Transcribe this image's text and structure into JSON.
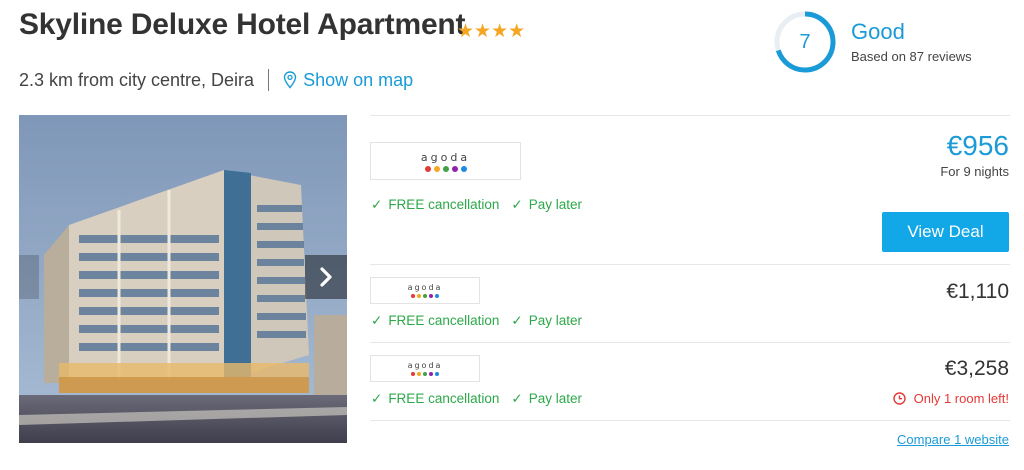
{
  "hotel": {
    "name": "Skyline Deluxe Hotel Apartment",
    "stars": "★★★★",
    "star_count": 4,
    "distance": "2.3 km from city centre, Deira",
    "map_link": "Show on map"
  },
  "rating": {
    "score": "7",
    "fraction": 0.7,
    "label": "Good",
    "reviews": "Based on 87 reviews"
  },
  "deals": [
    {
      "provider": "agoda",
      "features": [
        "FREE cancellation",
        "Pay later"
      ],
      "price": "€956",
      "price_note": "For 9 nights",
      "cta": "View Deal"
    },
    {
      "provider": "agoda",
      "features": [
        "FREE cancellation",
        "Pay later"
      ],
      "price": "€1,110"
    },
    {
      "provider": "agoda",
      "features": [
        "FREE cancellation",
        "Pay later"
      ],
      "price": "€3,258",
      "warning": "Only 1 room left!"
    }
  ],
  "compare_link": "Compare 1 website",
  "colors": {
    "accent": "#1a9bd7",
    "button": "#12a7e6",
    "star": "#f5a623",
    "feature_green": "#2da84a",
    "warning_red": "#e53935",
    "agoda_dots": [
      "#e53935",
      "#f5a623",
      "#43a047",
      "#8e24aa",
      "#1e88e5"
    ]
  },
  "icons": {
    "map": "map-pin-icon",
    "check": "check-icon",
    "next": "chevron-right-icon",
    "warning": "clock-icon"
  }
}
